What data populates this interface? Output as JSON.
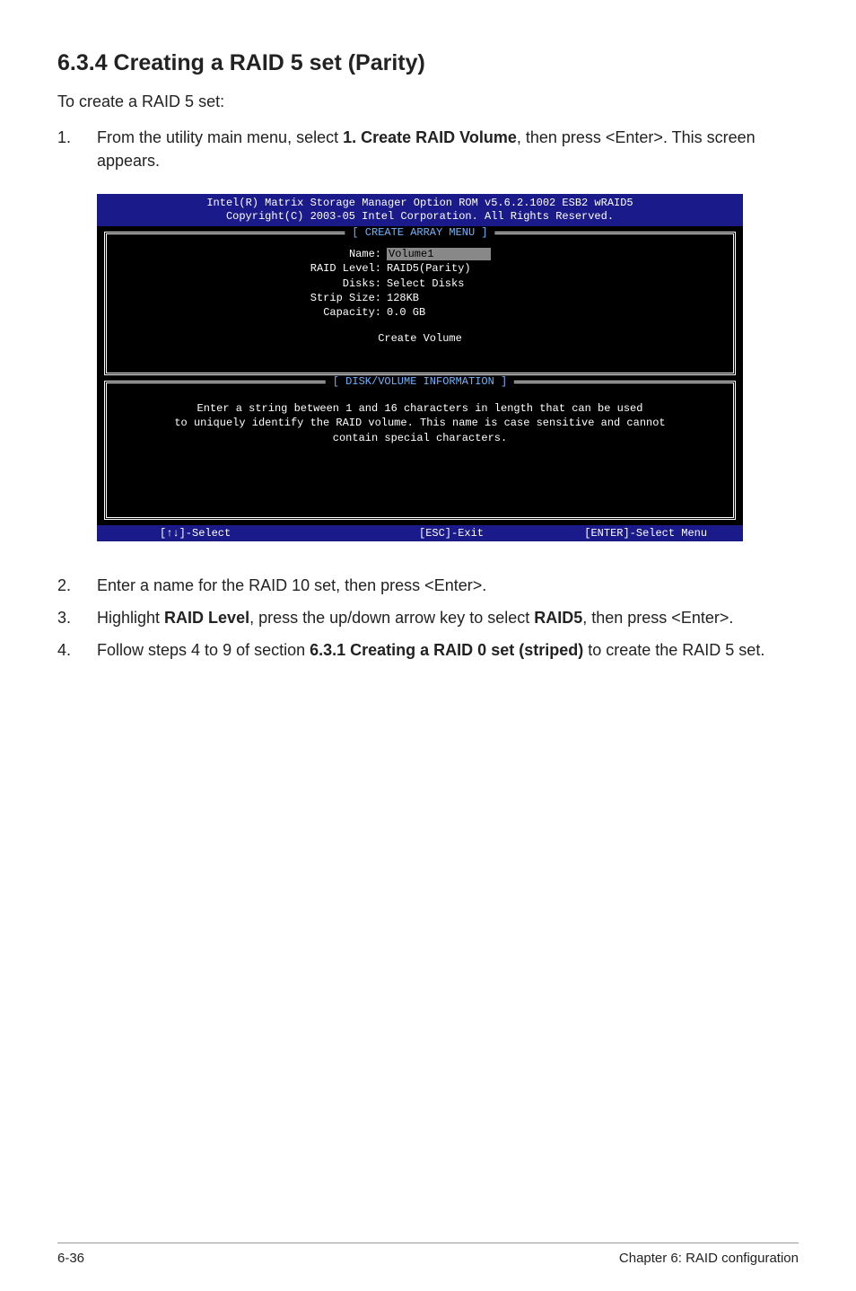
{
  "section_title": "6.3.4     Creating a RAID 5 set (Parity)",
  "intro": "To create a RAID 5 set:",
  "step1": {
    "num": "1.",
    "pre": "From the utility main menu, select ",
    "bold": "1. Create RAID Volume",
    "post": ", then press <Enter>. This screen appears."
  },
  "console": {
    "header_line1": "Intel(R) Matrix Storage Manager Option ROM v5.6.2.1002 ESB2 wRAID5",
    "header_line2": "Copyright(C) 2003-05 Intel Corporation. All Rights Reserved.",
    "panel1_title": "[ CREATE ARRAY MENU ]",
    "rows": {
      "name_k": "Name:",
      "name_v": "Volume1",
      "raidlevel_k": "RAID Level:",
      "raidlevel_v": "RAID5(Parity)",
      "disks_k": "Disks:",
      "disks_v": "Select Disks",
      "strip_k": "Strip Size:",
      "strip_v": "128KB",
      "capacity_k": "Capacity:",
      "capacity_v": "0.0   GB"
    },
    "create_label": "Create Volume",
    "panel2_title": "[ DISK/VOLUME INFORMATION ]",
    "info_line1": "Enter a string between 1 and 16 characters in length that can be used",
    "info_line2": "to uniquely identify the RAID volume. This name is case sensitive and cannot",
    "info_line3": "contain special characters.",
    "footer_select": "[↑↓]-Select",
    "footer_exit": "[ESC]-Exit",
    "footer_enter": "[ENTER]-Select Menu"
  },
  "step2": {
    "num": "2.",
    "text": "Enter a name for the RAID 10 set, then press <Enter>."
  },
  "step3": {
    "num": "3.",
    "pre": "Highlight ",
    "b1": "RAID Level",
    "mid": ", press the up/down arrow key to select ",
    "b2": "RAID5",
    "post": ", then press <Enter>."
  },
  "step4": {
    "num": "4.",
    "pre": "Follow steps 4 to 9 of section ",
    "b1": "6.3.1 Creating a RAID 0 set (striped)",
    "post": " to create the RAID 5 set."
  },
  "footer_left": "6-36",
  "footer_right": "Chapter 6: RAID configuration"
}
